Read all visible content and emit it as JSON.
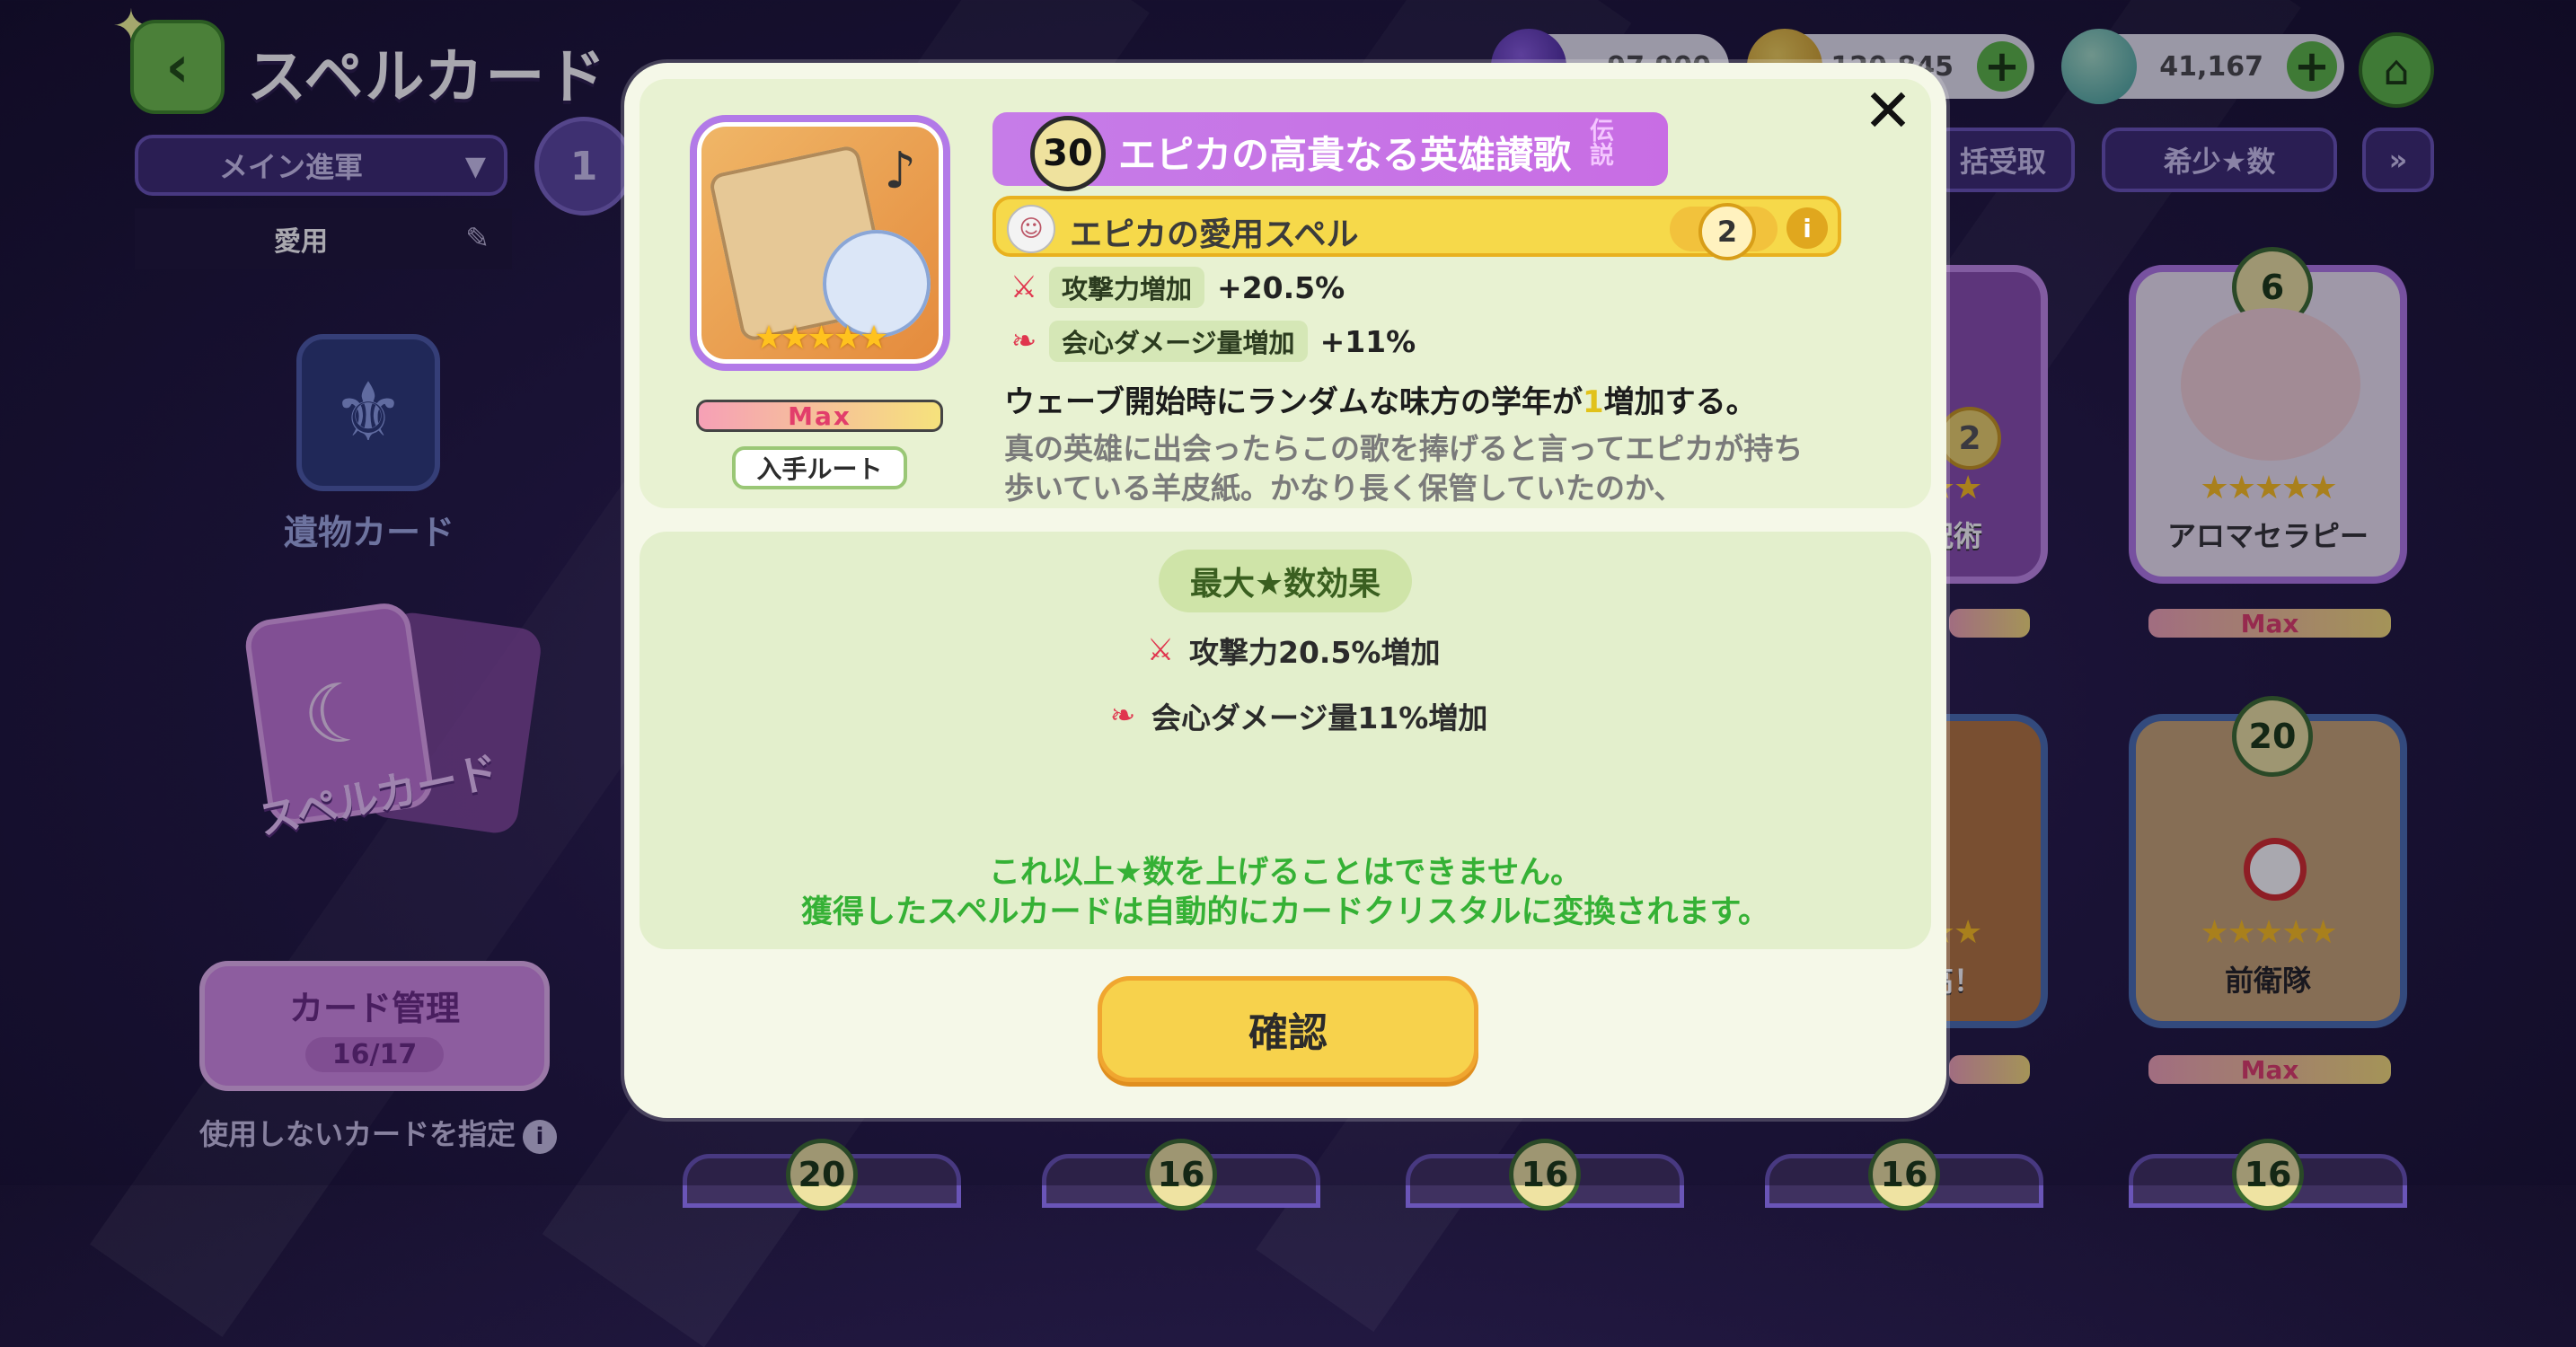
{
  "header": {
    "back_icon": "chevron-left-icon",
    "title": "スペルカード",
    "currencies": [
      {
        "icon": "purple-gem-icon",
        "amount": "97,900"
      },
      {
        "icon": "gold-coin-icon",
        "amount": "1,120,845"
      },
      {
        "icon": "butterfly-icon",
        "amount": "41,167"
      }
    ],
    "home_icon": "home-icon"
  },
  "left_panel": {
    "deck_select": "メイン進軍",
    "deck_number": "1",
    "tab_label": "愛用",
    "nav_relic": "遺物カード",
    "nav_spell": "スペルカード",
    "card_mgmt_label": "カード管理",
    "card_mgmt_count": "16/17",
    "unused_hint": "使用しないカードを指定"
  },
  "filters": {
    "bulk_receive": "括受取",
    "sort": "希少★数"
  },
  "right_cards": [
    {
      "label": "呪術",
      "level": "",
      "badge": "2"
    },
    {
      "label": "アロマセラピー",
      "level": "6",
      "max": "Max"
    },
    {
      "label": "高！",
      "level": ""
    },
    {
      "label": "前衛隊",
      "level": "20",
      "max": "Max"
    }
  ],
  "bottom_levels": [
    "20",
    "16",
    "16",
    "16",
    "16"
  ],
  "modal": {
    "level": "30",
    "title": "エピカの高貴なる英雄讃歌",
    "rarity": "伝説",
    "art_stars": "★★★★★",
    "max_label": "Max",
    "route_button": "入手ルート",
    "favorite_label": "エピカの愛用スペル",
    "favorite_level": "2",
    "stats": [
      {
        "icon": "attack-up-icon",
        "name": "攻撃力増加",
        "value": "+20.5%"
      },
      {
        "icon": "crit-damage-icon",
        "name": "会心ダメージ量増加",
        "value": "+11%"
      }
    ],
    "effect_pre": "ウェーブ開始時にランダムな味方の学年が",
    "effect_num": "1",
    "effect_post": "増加する。",
    "description": "真の英雄に出会ったらこの歌を捧げると言ってエピカが持ち歩いている羊皮紙。かなり長く保管していたのか、",
    "max_effect_title": "最大★数効果",
    "max_effects": [
      "攻撃力20.5%増加",
      "会心ダメージ量11%増加"
    ],
    "notice_line1": "これ以上★数を上げることはできません。",
    "notice_line2": "獲得したスペルカードは自動的にカードクリスタルに変換されます。",
    "confirm_button": "確認"
  }
}
